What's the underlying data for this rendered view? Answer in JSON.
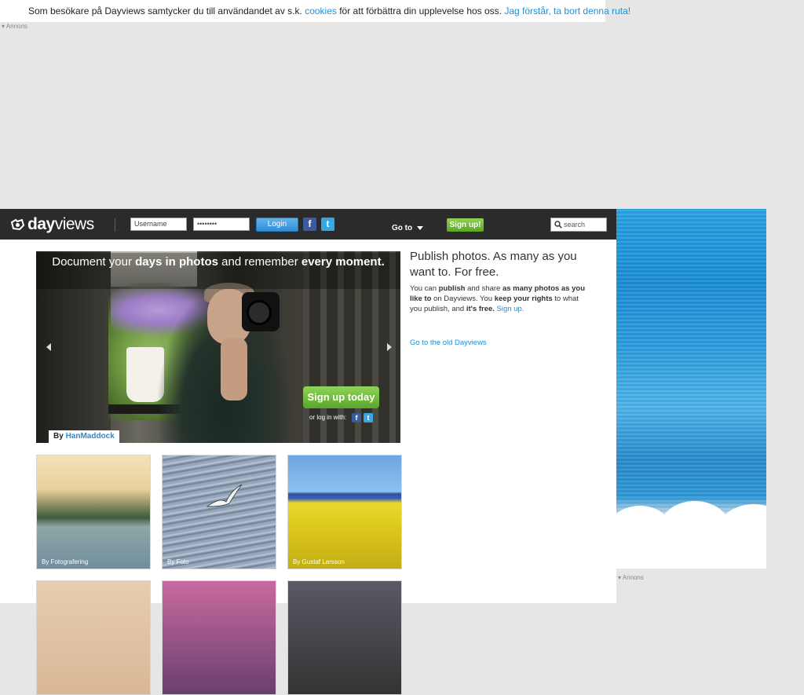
{
  "cookie_bar": {
    "text_before": "Som besökare på Dayviews samtycker du till användandet av s.k.",
    "cookies_link": "cookies",
    "text_after": "för att förbättra din upplevelse hos oss.",
    "dismiss_link": "Jag förstår, ta bort denna ruta!"
  },
  "ads": {
    "label": "▾ Annons"
  },
  "header": {
    "logo": {
      "bold": "day",
      "light": "views"
    },
    "username_placeholder": "Username",
    "password_value": "••••••••",
    "login_label": "Login",
    "facebook_icon": "f",
    "twitter_icon": "t",
    "goto_label": "Go to",
    "signup_label": "Sign up!",
    "search_placeholder": "search"
  },
  "hero": {
    "title_1": "Document your",
    "title_2": "days in photos",
    "title_3": "and remember",
    "title_4": "every moment.",
    "cta_label": "Sign up today",
    "login_with": "or log in with:",
    "credit_by": "By",
    "credit_author": "HanMaddock"
  },
  "right_column": {
    "title": "Publish photos. As many as you want to. For free.",
    "body_1": "You can",
    "body_2": "publish",
    "body_3": "and share",
    "body_4": "as many photos as you like to",
    "body_5": "on Dayviews. You",
    "body_6": "keep your rights",
    "body_7": "to what you publish, and",
    "body_8": "it's free.",
    "signup_link": "Sign up.",
    "old_link": "Go to the old Dayviews"
  },
  "photos": [
    {
      "caption": "By Fotografering"
    },
    {
      "caption": "By Foto"
    },
    {
      "caption": "By Gustaf Larsson"
    },
    {
      "caption": ""
    },
    {
      "caption": ""
    },
    {
      "caption": ""
    }
  ],
  "colors": {
    "accent_blue": "#1f8fd6",
    "signup_green": "#6fbf3a",
    "topbar": "#2b2b2b"
  }
}
